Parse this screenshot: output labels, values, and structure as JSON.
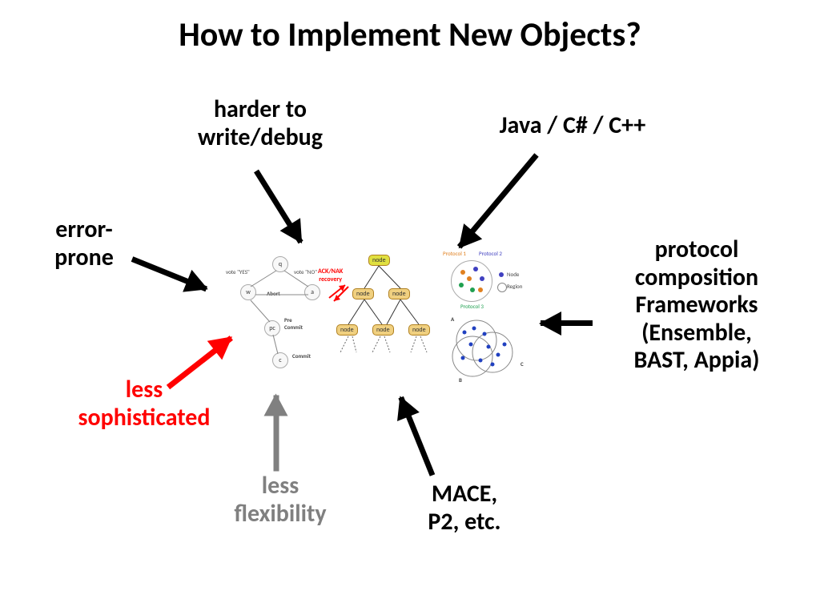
{
  "title": "How to Implement New Objects?",
  "labels": {
    "harder": "harder to\nwrite/debug",
    "java": "Java / C# / C++",
    "error": "error-\nprone",
    "protocol": "protocol\ncomposition\nFrameworks\n(Ensemble,\nBAST, Appia)",
    "less_soph": "less\nsophisticated",
    "less_flex": "less\nflexibility",
    "mace": "MACE,\nP2, etc."
  },
  "center": {
    "ack": "ACK/NAK\nrecovery",
    "vote_yes": "vote \"YES\"",
    "vote_no": "vote \"NO\"",
    "abort": "Abort",
    "precommit": "Pre\nCommit",
    "commit": "Commit",
    "q": "q",
    "w": "w",
    "a": "a",
    "pc": "pc",
    "c": "c",
    "node": "node",
    "proto1": "Protocol 1",
    "proto2": "Protocol 2",
    "proto3": "Protocol 3",
    "nodelabel": "Node",
    "region": "Region",
    "A": "A",
    "B": "B",
    "C": "C"
  }
}
